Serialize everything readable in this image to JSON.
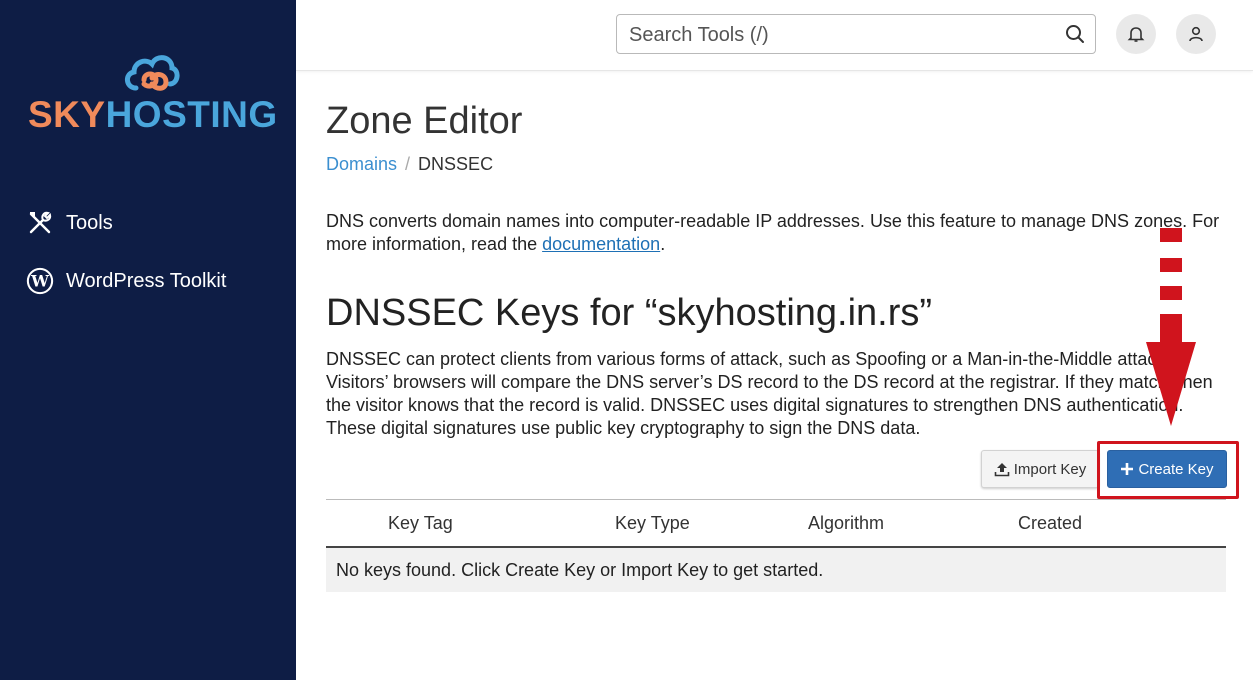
{
  "brand": {
    "logo_part1": "SKY",
    "logo_part2": "HOSTING",
    "color_sky": "#f08a5b",
    "color_hosting": "#4aa6dc",
    "sidebar_bg": "#0e1d45"
  },
  "sidebar": {
    "items": [
      {
        "label": "Tools",
        "icon": "tools-icon"
      },
      {
        "label": "WordPress Toolkit",
        "icon": "wordpress-icon"
      }
    ]
  },
  "header": {
    "search_placeholder": "Search Tools (/)",
    "icons": [
      "search-icon",
      "bell-icon",
      "user-icon"
    ]
  },
  "page": {
    "title": "Zone Editor",
    "breadcrumb": [
      {
        "label": "Domains"
      },
      {
        "label": "DNSSEC"
      }
    ],
    "intro_text": "DNS converts domain names into computer-readable IP addresses. Use this feature to manage DNS zones. For more information, read the ",
    "intro_link": "documentation",
    "intro_end": ".",
    "section_title": "DNSSEC Keys for “skyhosting.in.rs”",
    "section_desc": "DNSSEC can protect clients from various forms of attack, such as Spoofing or a Man-in-the-Middle attack. Visitors’ browsers will compare the DNS server’s DS record to the DS record at the registrar. If they match, then the visitor knows that the record is valid. DNSSEC uses digital signatures to strengthen DNS authentication. These digital signatures use public key cryptography to sign the DNS data."
  },
  "actions": {
    "import_label": "Import Key",
    "create_label": "Create Key",
    "accent_color": "#2f6eb5",
    "highlight_color": "#d0141d"
  },
  "table": {
    "columns": [
      "Key Tag",
      "Key Type",
      "Algorithm",
      "Created"
    ],
    "empty_message": "No keys found. Click Create Key or Import Key to get started."
  }
}
